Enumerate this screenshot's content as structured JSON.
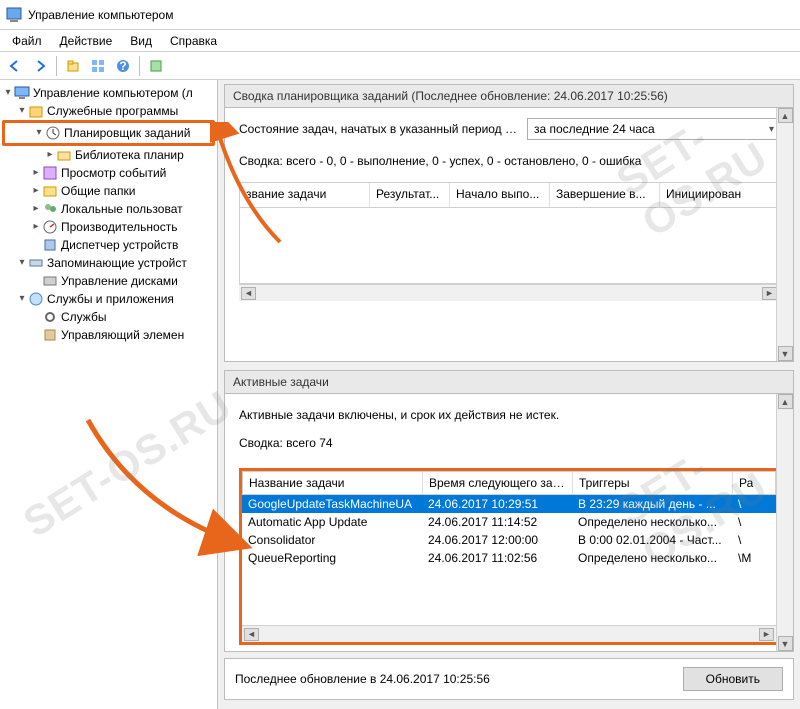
{
  "window": {
    "title": "Управление компьютером"
  },
  "menu": {
    "file": "Файл",
    "action": "Действие",
    "view": "Вид",
    "help": "Справка"
  },
  "tree": {
    "root": "Управление компьютером (л",
    "system_tools": "Служебные программы",
    "task_scheduler": "Планировщик заданий",
    "task_lib": "Библиотека планир",
    "event_viewer": "Просмотр событий",
    "shared_folders": "Общие папки",
    "local_users": "Локальные пользоват",
    "performance": "Производительность",
    "device_manager": "Диспетчер устройств",
    "storage": "Запоминающие устройст",
    "disk_mgmt": "Управление дисками",
    "services_apps": "Службы и приложения",
    "services": "Службы",
    "wmi": "Управляющий элемен"
  },
  "summary": {
    "header": "Сводка планировщика заданий (Последнее обновление: 24.06.2017 10:25:56)",
    "period_label": "Состояние задач, начатых в указанный период в...",
    "period_value": "за последние 24 часа",
    "line": "Сводка: всего - 0, 0 - выполнение, 0 - успех, 0 - остановлено, 0 - ошибка",
    "cols": {
      "name": "звание задачи",
      "result": "Результат...",
      "start": "Начало выпо...",
      "end": "Завершение в...",
      "init": "Инициирован"
    }
  },
  "active": {
    "header": "Активные задачи",
    "info": "Активные задачи включены, и срок их действия не истек.",
    "summary": "Сводка: всего 74",
    "cols": {
      "name": "Название задачи",
      "next": "Время следующего зап...",
      "triggers": "Триггеры",
      "path": "Ра"
    },
    "rows": [
      {
        "name": "GoogleUpdateTaskMachineUA",
        "next": "24.06.2017 10:29:51",
        "triggers": "В 23:29 каждый день - ...",
        "path": "\\"
      },
      {
        "name": "Automatic App Update",
        "next": "24.06.2017 11:14:52",
        "triggers": "Определено несколько...",
        "path": "\\"
      },
      {
        "name": "Consolidator",
        "next": "24.06.2017 12:00:00",
        "triggers": "В 0:00 02.01.2004 - Част...",
        "path": "\\"
      },
      {
        "name": "QueueReporting",
        "next": "24.06.2017 11:02:56",
        "triggers": "Определено несколько...",
        "path": "\\M"
      }
    ]
  },
  "footer": {
    "updated": "Последнее обновление в 24.06.2017 10:25:56",
    "refresh": "Обновить"
  },
  "watermark": "SET-OS.RU"
}
